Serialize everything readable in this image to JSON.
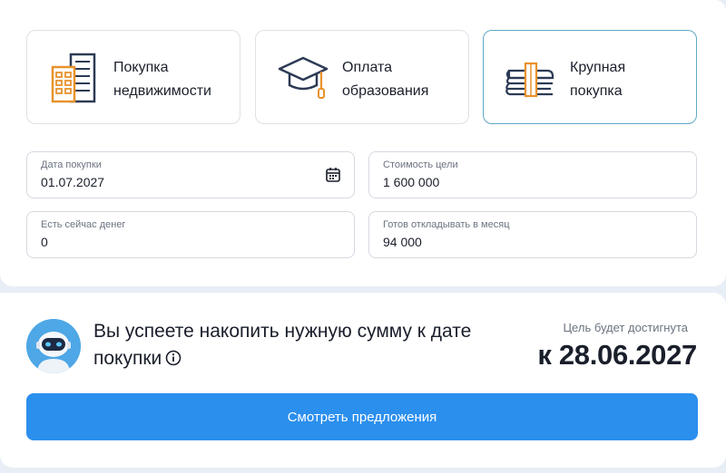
{
  "goals": [
    {
      "label": "Покупка\nнедвижимости",
      "icon": "building-icon",
      "selected": false
    },
    {
      "label": "Оплата\nобразования",
      "icon": "graduation-cap-icon",
      "selected": false
    },
    {
      "label": "Крупная\nпокупка",
      "icon": "money-stack-icon",
      "selected": true
    }
  ],
  "fields": {
    "purchase_date": {
      "label": "Дата покупки",
      "value": "01.07.2027"
    },
    "goal_cost": {
      "label": "Стоимость цели",
      "value": "1 600 000"
    },
    "current_money": {
      "label": "Есть сейчас денег",
      "value": "0"
    },
    "monthly_saving": {
      "label": "Готов откладывать в месяц",
      "value": "94 000"
    }
  },
  "result": {
    "message": "Вы успеете накопить нужную сумму к дате покупки",
    "goal_caption": "Цель будет достигнута",
    "goal_date": "к 28.06.2027"
  },
  "offers_button_label": "Смотреть предложения",
  "colors": {
    "accent": "#2b8fee",
    "selected_border": "#5fa7c4",
    "icon_orange": "#e8922c",
    "icon_navy": "#2c3a55"
  }
}
